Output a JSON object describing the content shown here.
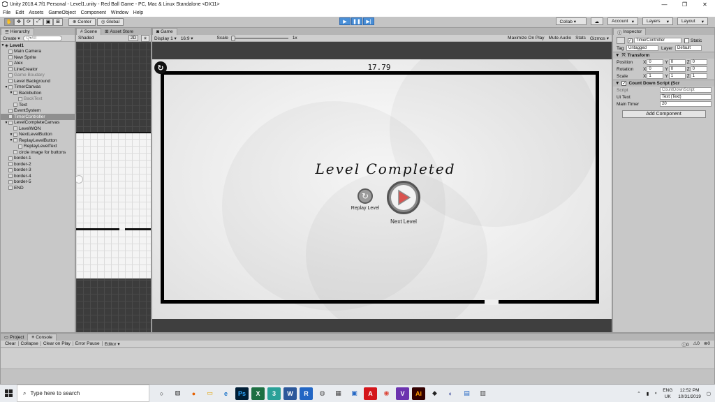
{
  "window": {
    "title": "Unity 2018.4.7f1 Personal - Level1.unity - Red Ball Game - PC, Mac & Linux Standalone <DX11>",
    "controls": [
      "—",
      "❐",
      "✕"
    ]
  },
  "menu": [
    "File",
    "Edit",
    "Assets",
    "GameObject",
    "Component",
    "Window",
    "Help"
  ],
  "toolbar": {
    "pivot": "Center",
    "space": "Global",
    "collab": "Collab ▾",
    "account": "Account",
    "layers": "Layers",
    "layout": "Layout"
  },
  "hierarchy": {
    "tab": "Hierarchy",
    "create": "Create ▾",
    "search_placeholder": "Q▾All",
    "root": "Level1",
    "items": [
      {
        "label": "Main Camera",
        "depth": 1
      },
      {
        "label": "New Sprite",
        "depth": 1
      },
      {
        "label": "Alex",
        "depth": 1
      },
      {
        "label": "LineCreator",
        "depth": 1
      },
      {
        "label": "Game Boudary",
        "depth": 1,
        "dim": true
      },
      {
        "label": "Level Background",
        "depth": 1
      },
      {
        "label": "TimerCanvas",
        "depth": 1,
        "arrow": true
      },
      {
        "label": "Backbutton",
        "depth": 2,
        "arrow": true
      },
      {
        "label": "BackText",
        "depth": 3,
        "dim": true
      },
      {
        "label": "Text",
        "depth": 2
      },
      {
        "label": "EventSystem",
        "depth": 1
      },
      {
        "label": "TimerController",
        "depth": 1,
        "selected": true
      },
      {
        "label": "LevelCompleteCanvas",
        "depth": 1,
        "arrow": true
      },
      {
        "label": "LevelWON",
        "depth": 2
      },
      {
        "label": "NextLevelButton",
        "depth": 2,
        "arrow": true
      },
      {
        "label": "ReplayLevelButton",
        "depth": 2,
        "arrow": true
      },
      {
        "label": "ReplayLevelText",
        "depth": 3
      },
      {
        "label": "circle image for buttons",
        "depth": 2
      },
      {
        "label": "border-1",
        "depth": 1
      },
      {
        "label": "border-2",
        "depth": 1
      },
      {
        "label": "border-3",
        "depth": 1
      },
      {
        "label": "border-4",
        "depth": 1
      },
      {
        "label": "border-5",
        "depth": 1
      },
      {
        "label": "END",
        "depth": 1
      }
    ]
  },
  "scene": {
    "tabs": [
      "Scene",
      "Asset Store"
    ],
    "shading": "Shaded",
    "mode2d": "2D"
  },
  "game": {
    "tab": "Game",
    "display": "Display 1",
    "aspect": "16:9",
    "scale_label": "Scale",
    "scale_value": "1x",
    "options": [
      "Maximize On Play",
      "Mute Audio",
      "Stats",
      "Gizmos ▾"
    ],
    "timer": "17.79",
    "level_title": "Level Completed",
    "replay_label": "Replay Level",
    "next_label": "Next Level"
  },
  "inspector": {
    "tab": "Inspector",
    "object_name": "TimerController",
    "static_label": "Static",
    "tag_label": "Tag",
    "tag_value": "Untagged",
    "layer_label": "Layer",
    "layer_value": "Default",
    "transform": {
      "title": "Transform",
      "rows": [
        {
          "label": "Position",
          "x": "0",
          "y": "0",
          "z": "0"
        },
        {
          "label": "Rotation",
          "x": "0",
          "y": "0",
          "z": "0"
        },
        {
          "label": "Scale",
          "x": "1",
          "y": "1",
          "z": "1"
        }
      ]
    },
    "script_comp": {
      "title": "Count Down Script (Scr",
      "script_label": "Script",
      "script_value": "CountDownScript",
      "uitext_label": "Ui Text",
      "uitext_value": "Text (Text)",
      "timer_label": "Main Timer",
      "timer_value": "20"
    },
    "add_component": "Add Component"
  },
  "console": {
    "tabs": [
      "Project",
      "Console"
    ],
    "buttons": [
      "Clear",
      "Collapse",
      "Clear on Play",
      "Error Pause",
      "Editor ▾"
    ],
    "counts": [
      "0",
      "0",
      "0"
    ]
  },
  "taskbar": {
    "search_placeholder": "Type here to search",
    "apps": [
      {
        "glyph": "○",
        "color": "#222222",
        "bg": "transparent"
      },
      {
        "glyph": "⊟",
        "color": "#222222",
        "bg": "transparent"
      },
      {
        "glyph": "●",
        "color": "#e66000",
        "bg": "transparent"
      },
      {
        "glyph": "▭",
        "color": "#e0a100",
        "bg": "transparent"
      },
      {
        "glyph": "e",
        "color": "#1a73c9",
        "bg": "transparent"
      },
      {
        "glyph": "Ps",
        "color": "#31a8ff",
        "bg": "#001e36"
      },
      {
        "glyph": "X",
        "color": "#ffffff",
        "bg": "#1d6f42"
      },
      {
        "glyph": "3",
        "color": "#ffffff",
        "bg": "#2aa198"
      },
      {
        "glyph": "W",
        "color": "#ffffff",
        "bg": "#2b579a"
      },
      {
        "glyph": "R",
        "color": "#ffffff",
        "bg": "#2266c4"
      },
      {
        "glyph": "◍",
        "color": "#555555",
        "bg": "transparent"
      },
      {
        "glyph": "▦",
        "color": "#444444",
        "bg": "transparent"
      },
      {
        "glyph": "▣",
        "color": "#2266c4",
        "bg": "transparent"
      },
      {
        "glyph": "A",
        "color": "#ffffff",
        "bg": "#d4161b"
      },
      {
        "glyph": "◉",
        "color": "#db4437",
        "bg": "transparent"
      },
      {
        "glyph": "V",
        "color": "#ffffff",
        "bg": "#6c33af"
      },
      {
        "glyph": "Ai",
        "color": "#ff9a00",
        "bg": "#330000"
      },
      {
        "glyph": "◆",
        "color": "#222222",
        "bg": "transparent"
      },
      {
        "glyph": "◐",
        "color": "#3b4a9c",
        "bg": "transparent"
      },
      {
        "glyph": "▤",
        "color": "#2266c4",
        "bg": "transparent"
      },
      {
        "glyph": "▥",
        "color": "#444444",
        "bg": "transparent"
      }
    ],
    "lang": "ENG",
    "region": "UK",
    "time": "12:52 PM",
    "date": "10/31/2019"
  }
}
